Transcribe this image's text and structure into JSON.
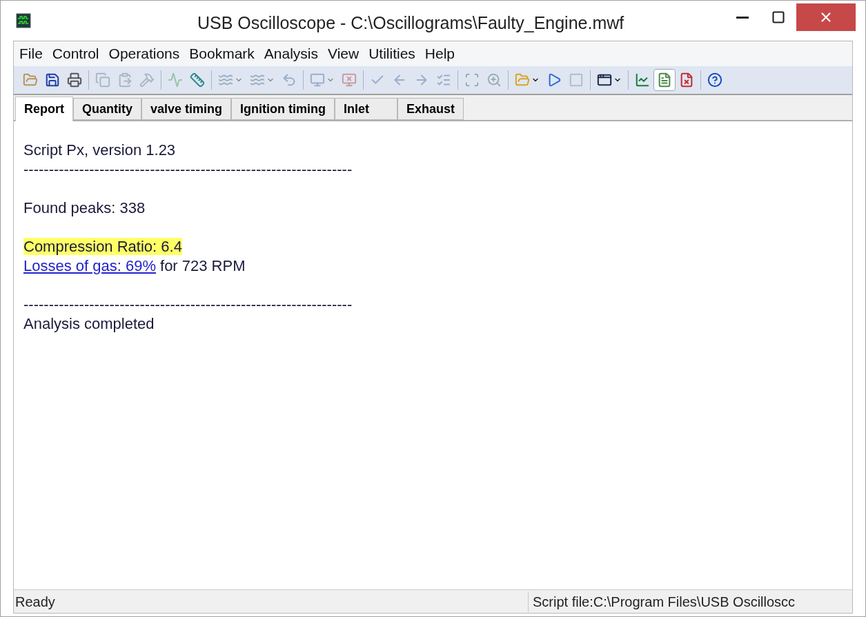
{
  "window": {
    "title": "USB Oscilloscope - C:\\Oscillograms\\Faulty_Engine.mwf"
  },
  "menu": [
    "File",
    "Control",
    "Operations",
    "Bookmark",
    "Analysis",
    "View",
    "Utilities",
    "Help"
  ],
  "toolbar": [
    {
      "kind": "open",
      "disabled": false,
      "dropdown": false,
      "pressed": false
    },
    {
      "kind": "save",
      "disabled": false,
      "dropdown": false,
      "pressed": false
    },
    {
      "kind": "print",
      "disabled": false,
      "dropdown": false,
      "pressed": false
    },
    {
      "kind": "separator"
    },
    {
      "kind": "wave-copy",
      "disabled": true,
      "dropdown": false,
      "pressed": false
    },
    {
      "kind": "wave-paste",
      "disabled": true,
      "dropdown": false,
      "pressed": false
    },
    {
      "kind": "hammer",
      "disabled": true,
      "dropdown": false,
      "pressed": false
    },
    {
      "kind": "separator"
    },
    {
      "kind": "peak",
      "disabled": true,
      "dropdown": false,
      "pressed": false
    },
    {
      "kind": "measure",
      "disabled": false,
      "dropdown": false,
      "pressed": false
    },
    {
      "kind": "separator"
    },
    {
      "kind": "scale",
      "disabled": true,
      "dropdown": true,
      "pressed": false
    },
    {
      "kind": "scale",
      "disabled": true,
      "dropdown": true,
      "pressed": false
    },
    {
      "kind": "undo",
      "disabled": true,
      "dropdown": false,
      "pressed": false
    },
    {
      "kind": "separator"
    },
    {
      "kind": "monitor",
      "disabled": true,
      "dropdown": true,
      "pressed": false
    },
    {
      "kind": "monitor-delete",
      "disabled": true,
      "dropdown": false,
      "pressed": false
    },
    {
      "kind": "separator"
    },
    {
      "kind": "check",
      "disabled": true,
      "dropdown": false,
      "pressed": false
    },
    {
      "kind": "check-back",
      "disabled": true,
      "dropdown": false,
      "pressed": false
    },
    {
      "kind": "check-forward",
      "disabled": true,
      "dropdown": false,
      "pressed": false
    },
    {
      "kind": "checklist",
      "disabled": true,
      "dropdown": false,
      "pressed": false
    },
    {
      "kind": "separator"
    },
    {
      "kind": "frame",
      "disabled": true,
      "dropdown": false,
      "pressed": false
    },
    {
      "kind": "zoom",
      "disabled": true,
      "dropdown": false,
      "pressed": false
    },
    {
      "kind": "separator"
    },
    {
      "kind": "script-open",
      "disabled": false,
      "dropdown": true,
      "pressed": false
    },
    {
      "kind": "script-run",
      "disabled": false,
      "dropdown": false,
      "pressed": false
    },
    {
      "kind": "script-stop",
      "disabled": true,
      "dropdown": false,
      "pressed": false
    },
    {
      "kind": "separator"
    },
    {
      "kind": "script-window",
      "disabled": false,
      "dropdown": true,
      "pressed": false
    },
    {
      "kind": "separator"
    },
    {
      "kind": "scope",
      "disabled": false,
      "dropdown": false,
      "pressed": false
    },
    {
      "kind": "report",
      "disabled": false,
      "dropdown": false,
      "pressed": true
    },
    {
      "kind": "report-delete",
      "disabled": false,
      "dropdown": false,
      "pressed": false
    },
    {
      "kind": "separator"
    },
    {
      "kind": "help",
      "disabled": false,
      "dropdown": false,
      "pressed": false
    }
  ],
  "tabs": [
    {
      "label": "Report",
      "selected": true
    },
    {
      "label": "Quantity",
      "selected": false
    },
    {
      "label": "valve timing",
      "selected": false
    },
    {
      "label": "Ignition timing",
      "selected": false
    },
    {
      "label": "Inlet",
      "selected": false
    },
    {
      "label": "Exhaust",
      "selected": false
    }
  ],
  "report": [
    {
      "kind": "text",
      "text": "Script Px, version 1.23"
    },
    {
      "kind": "text",
      "text": "-----------------------------------------------------------------"
    },
    {
      "kind": "blank"
    },
    {
      "kind": "text",
      "text": "Found peaks: 338"
    },
    {
      "kind": "blank"
    },
    {
      "kind": "highlight",
      "text": "Compression Ratio: 6.4"
    },
    {
      "kind": "link",
      "link": "Losses of gas: 69%",
      "text": "for 723 RPM"
    },
    {
      "kind": "blank"
    },
    {
      "kind": "text",
      "text": "-----------------------------------------------------------------"
    },
    {
      "kind": "text",
      "text": "Analysis completed"
    }
  ],
  "status_bar": [
    "Ready",
    "Script file:C:\\Program Files\\USB Oscilloscc"
  ]
}
